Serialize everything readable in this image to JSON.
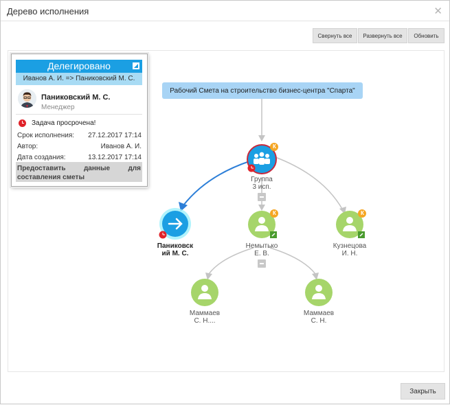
{
  "window": {
    "title": "Дерево исполнения",
    "close_icon": "close-icon"
  },
  "toolbar": {
    "collapse_all": "Свернуть все",
    "expand_all": "Развернуть все",
    "refresh": "Обновить"
  },
  "card": {
    "status": "Делегировано",
    "route": "Иванов А. И. => Паниковский М. С.",
    "name": "Паниковский М. С.",
    "role": "Менеджер",
    "overdue": "Задача просрочена!",
    "due_label": "Срок исполнения:",
    "due_value": "27.12.2017 17:14",
    "author_label": "Автор:",
    "author_value": "Иванов А. И.",
    "created_label": "Дата создания:",
    "created_value": "13.12.2017 17:14",
    "description": "Предоставить данные для составления сметы"
  },
  "tree": {
    "root": "Рабочий Смета на строительство бизнес-центра \"Спарта\"",
    "group_line1": "Группа",
    "group_line2": "3 исп.",
    "panikovsky_line1": "Паниковск",
    "panikovsky_line2": "ий М. С.",
    "nemytko_line1": "Немытько",
    "nemytko_line2": "Е. В.",
    "kuznetsova_line1": "Кузнецова",
    "kuznetsova_line2": "И. Н.",
    "mammaev1_line1": "Маммаев",
    "mammaev1_line2": "С. Н....",
    "mammaev2_line1": "Маммаев",
    "mammaev2_line2": "С. Н.",
    "badge_letter": "К"
  },
  "footer": {
    "close": "Закрыть"
  },
  "colors": {
    "accent_blue": "#1b9fe3",
    "light_blue": "#a8dbf4",
    "node_green": "#a6d56a",
    "overdue_red": "#e0232a",
    "badge_orange": "#f5a623",
    "arrow_blue": "#2d7fd8"
  }
}
